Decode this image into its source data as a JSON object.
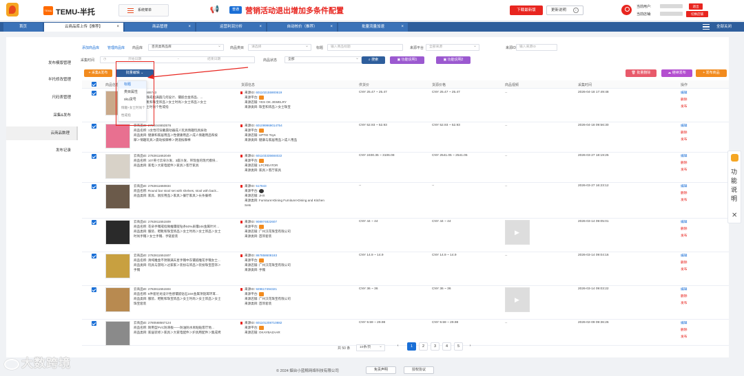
{
  "header": {
    "brand_badge": "TEMU",
    "brand": "TEMU-半托",
    "system_menu": "系统菜单",
    "notice_tag": "普通",
    "notice": "营销活动退出增加多条件配置",
    "download_button": "下载最新版",
    "update_button": "更新说明",
    "current_user_label": "当前用户:",
    "current_store_label": "当前店铺:",
    "logout": "退出",
    "switch_store": "切换店铺"
  },
  "tabs": [
    {
      "label": "首页"
    },
    {
      "label": "云商品库上传【推荐】",
      "active": true
    },
    {
      "label": "商品管理"
    },
    {
      "label": "运营利润分析"
    },
    {
      "label": "自动核价（推荐）"
    },
    {
      "label": "批量流量加速"
    }
  ],
  "close_all": "全部关闭",
  "sidebar": {
    "items": [
      {
        "label": "发布模版管理"
      },
      {
        "label": "半托修改管理"
      },
      {
        "label": "尺码表管理"
      },
      {
        "label": "采集&发布"
      },
      {
        "label": "云商品数理",
        "active": true
      },
      {
        "label": "发布记录"
      }
    ]
  },
  "filters": {
    "add_product": "添加商品库",
    "manage_product": "管理商品库",
    "library_label": "商品库",
    "library_value": "百货类商品库",
    "category_label": "商品类目",
    "category_placeholder": "请选择",
    "title_label": "标题",
    "title_placeholder": "输入商品标题",
    "source_platform_label": "来源平台",
    "source_platform_value": "全部来源",
    "source_id_label": "来源ID",
    "source_id_placeholder": "输入来源ID",
    "collect_time_label": "采集时间",
    "start_date": "开始日期",
    "date_sep": "-",
    "end_date": "结束日期",
    "status_label": "商品状态",
    "status_value": "全部",
    "search_button": "搜索",
    "help1": "功能说明1",
    "help2": "功能说明2"
  },
  "toolbar": {
    "collect_publish": "采集&发布",
    "batch_edit": "批量编辑",
    "batch_delete": "批量删除",
    "continue_publish": "继续发布",
    "publish_product": "发布商品"
  },
  "dropdown_menu": [
    "标题",
    "类目属性",
    "sku货号"
  ],
  "dropdown_overlay_text": "情趣+女士时尚个性戒指",
  "table": {
    "headers": [
      "商品信息",
      "货源信息",
      "供货价",
      "货源价格",
      "商品视频",
      "采集时间",
      "操作"
    ],
    "ops": {
      "edit": "编辑",
      "delete": "删除",
      "publish": "发布"
    },
    "rows": [
      {
        "product_lines": [
          "2780444665743",
          "一个仿珍珠戒指满圆几何设计、镶嵌合金饰品、...",
          "服装、鞋靴和珠宝饰品＞女士时尚＞女士饰品＞女士",
          "情趣＞女士时尚个性戒指"
        ],
        "source_id": "601102155900619",
        "source_platform_label": "来源平台:",
        "source_store": "来源店铺: YES OK JEWELRY",
        "source_category": "来源类目: 珠宝和饰品＞女士珠宝",
        "supply_price": "CNY 25.47 ~ 25.47",
        "source_price": "CNY 25.47 ~ 25.47",
        "video": "--",
        "time": "2026-04-18 17:49:48"
      },
      {
        "product_lines": [
          "云商品ID: 2780444653576",
          "商品名称: 1女性可穿戴震动器成人玩具情趣玩具振动",
          "商品类目: 健康和家居用品＞性健康用品＞成人情趣用品和按",
          "摩＞情趣玩具＞震动按摩棒＞阴道按摩棒"
        ],
        "source_id": "601099969014754",
        "source_platform_label": "来源平台:",
        "source_store": "来源店铺: UPTIE Toys",
        "source_category": "来源类目: 健康与家居用品＞成人用品",
        "supply_price": "CNY 52.93 ~ 52.93",
        "source_price": "CNY 52.93 ~ 52.93",
        "video": "--",
        "time": "2026-04-18 09:56:30"
      },
      {
        "product_lines": [
          "云商品ID: 2782811662049",
          "商品名称: 107英寸云朵沙发、3座沙发、带现金的现代模块...",
          "商品类目: 家电＞大家电配件＞家具＞客厅家具",
          ""
        ],
        "source_id": "601103335684022",
        "source_platform_label": "来源平台:",
        "source_store": "来源店铺: LFCREATOR",
        "source_category": "来源类目: 家具＞客厅家具",
        "supply_price": "CNY 2400.35 ~ 3106.08",
        "source_price": "CNY 2541.05 ~ 2541.05",
        "video": "--",
        "time": "2026-03-27 18:19:25"
      },
      {
        "product_lines": [
          "云商品ID: 2782811660834",
          "商品名称: Round bar stool set with shelves, stool with back...",
          "商品类目: 家具、厨房用品＞家具＞餐厅家具＞长条餐椅",
          ""
        ],
        "source_id": "517843",
        "source_platform_label": "来源平台:",
        "source_store": "来源店铺: JHX",
        "source_category": "来源类目: Furniture>Dining Furniture>Dining and Kitchen",
        "source_extra": "Sets",
        "supply_price": "--",
        "source_price": "--",
        "video": "--",
        "time": "2026-03-27 16:23:12"
      },
      {
        "product_lines": [
          "云商品ID: 2782811551509",
          "商品名称: 花朵手镯戒指微推镶嵌钻条50%表镶24k金属叶片...",
          "商品类目: 服装、鞋靴和珠宝饰品＞女士时尚＞女士饰品＞女士",
          "时尚手镯＞女士手镯、手链套装"
        ],
        "source_id": "908974822607",
        "source_platform_label": "来源平台:",
        "source_store": "来源店铺: 广州汉花珠宝有限公司",
        "source_category": "来源类目: 首饰套装",
        "supply_price": "CNY 44 ~ 44",
        "source_price": "CNY 44 ~ 44",
        "video": "has_video",
        "time": "2026-03-14 09:05:01"
      },
      {
        "product_lines": [
          "云商品ID: 2782811551507",
          "商品名称: 清纯雕金不锈钢满天星手镯中东镶嵌雕花手镯女士...",
          "商品类目: 玩具与游戏＞过家家＞装扮与饰品＞装扮珠宝首饰＞",
          "手镯"
        ],
        "source_id": "867858608183",
        "source_platform_label": "来源平台:",
        "source_store": "来源店铺: 广州汉花珠宝有限公司",
        "source_category": "来源类目: 手镯",
        "supply_price": "CNY 14.9 ~ 14.9",
        "source_price": "CNY 14.9 ~ 14.9",
        "video": "--",
        "time": "2026-03-14 09:04:16"
      },
      {
        "product_lines": [
          "云商品ID: 2782811551504",
          "商品名称: 6件套尼龙设计性感镶嵌钻石24K金属项链耳环耳...",
          "商品类目: 服装、鞋靴和珠宝饰品＞女士时尚＞女士饰品＞女士",
          "珠宝套装"
        ],
        "source_id": "929617494321",
        "source_platform_label": "来源平台:",
        "source_store": "来源店铺: 广州汉花珠宝有限公司",
        "source_category": "来源类目: 首饰套装",
        "supply_price": "CNY 36 ~ 36",
        "source_price": "CNY 36 ~ 36",
        "video": "has_video",
        "time": "2026-03-14 09:03:22"
      },
      {
        "product_lines": [
          "云商品ID: 2780568567124",
          "商品名称: 耐用型PVC防滑板——防油防水易粘贴客厅地...",
          "商品类目: 家居装修＞家具＞大家电配件＞炉具用配件＞集成烤",
          ""
        ],
        "source_id": "601101208710882",
        "source_platform_label": "来源平台:",
        "source_store": "来源店铺: OKAYBAZAAR",
        "source_category": "",
        "supply_price": "CNY 9.59 ~ 29.98",
        "source_price": "CNY 9.59 ~ 29.98",
        "video": "--",
        "time": "2026-02-09 09:36:26"
      }
    ]
  },
  "pagination": {
    "total": "共 50 条",
    "page_size": "10条/页",
    "pages": [
      "1",
      "2",
      "3",
      "4",
      "5"
    ],
    "current": "1",
    "prev": "‹",
    "next": "›"
  },
  "footer": {
    "copyright": "© 2024 烟台小蓝鲸网络科技有限公司",
    "disclaimer": "免责声明",
    "license": "授权协议"
  },
  "watermark": "大数跨境",
  "helper": {
    "text": "功能说明",
    "close": "✕"
  },
  "colors": {
    "primary": "#1a6fd6",
    "danger": "#e8251f",
    "nav": "#2e5e9c"
  }
}
